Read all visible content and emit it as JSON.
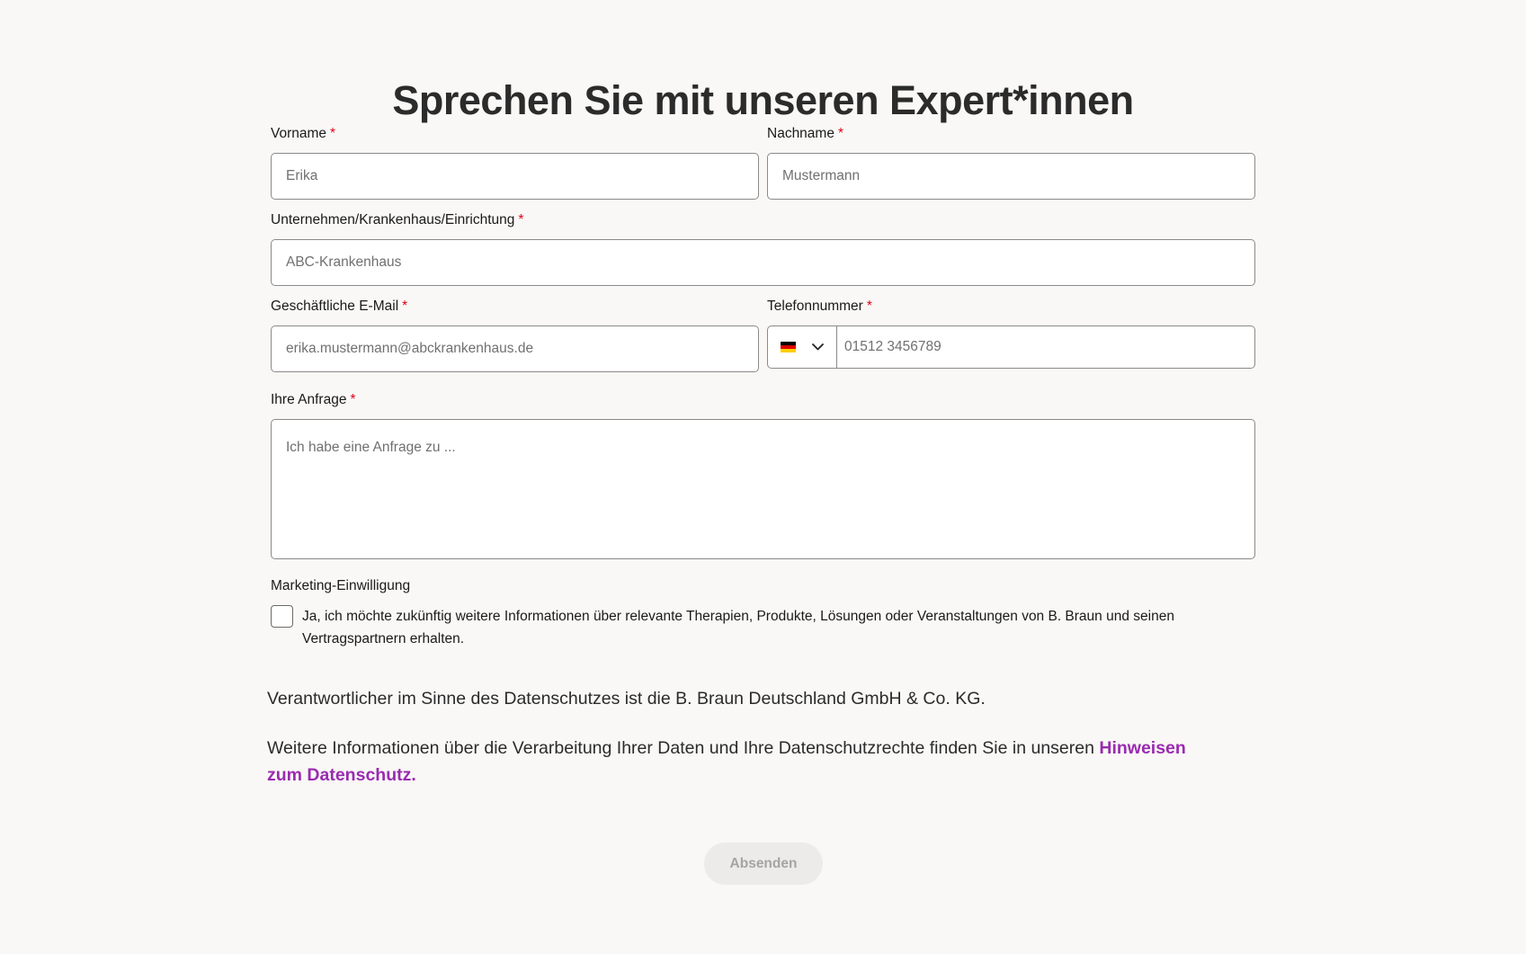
{
  "page": {
    "title": "Sprechen Sie mit unseren Expert*innen",
    "required_marker": "*"
  },
  "form": {
    "first_name": {
      "label": "Vorname",
      "placeholder": "Erika"
    },
    "last_name": {
      "label": "Nachname",
      "placeholder": "Mustermann"
    },
    "company": {
      "label": "Unternehmen/Krankenhaus/Einrichtung",
      "placeholder": "ABC-Krankenhaus"
    },
    "email": {
      "label": "Geschäftliche E-Mail",
      "placeholder": "erika.mustermann@abckrankenhaus.de"
    },
    "phone": {
      "label": "Telefonnummer",
      "placeholder": "01512 3456789",
      "country_icon": "flag-germany-icon",
      "flag_colors": [
        "#000000",
        "#dd0000",
        "#ffce00"
      ],
      "dropdown_icon": "chevron-down-icon"
    },
    "request": {
      "label": "Ihre Anfrage",
      "placeholder": "Ich habe eine Anfrage zu ..."
    },
    "marketing": {
      "label": "Marketing-Einwilligung",
      "checkbox_text": "Ja, ich möchte zukünftig weitere Informationen über relevante Therapien, Produkte, Lösungen oder Veranstaltungen von B. Braun und seinen Vertragspartnern erhalten.",
      "checked": false
    }
  },
  "privacy": {
    "controller_text": "Verantwortlicher im Sinne des Datenschutzes ist die B. Braun Deutschland GmbH & Co. KG.",
    "info_text": "Weitere Informationen über die Verarbeitung Ihrer Daten und Ihre Datenschutzrechte finden Sie in unseren ",
    "link_text": "Hinweisen zum Datenschutz."
  },
  "submit": {
    "label": "Absenden",
    "enabled": false
  },
  "colors": {
    "background": "#f9f8f6",
    "required": "#e0001b",
    "link": "#9a2bb0",
    "button_disabled_bg": "#ecebea",
    "button_disabled_text": "#a4a4a4"
  }
}
